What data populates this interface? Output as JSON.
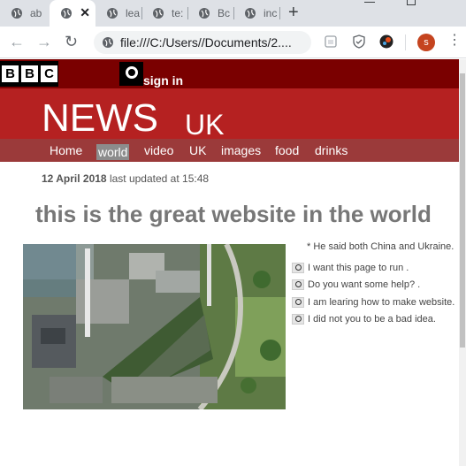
{
  "browser": {
    "tabs": [
      {
        "label": "ab"
      },
      {
        "label": "",
        "active": true
      },
      {
        "label": "lea"
      },
      {
        "label": "te:"
      },
      {
        "label": "Bc"
      },
      {
        "label": "inc"
      }
    ],
    "new_tab_label": "+",
    "url": "file:///C:/Users//Documents/2....",
    "profile_initial": "s"
  },
  "page": {
    "brand_letters": [
      "B",
      "B",
      "C"
    ],
    "signin_label": "sign in",
    "news_title": "NEWS",
    "news_region": "UK",
    "nav": [
      "Home",
      "world",
      "video",
      "UK",
      "images",
      "food",
      "drinks"
    ],
    "active_nav": "world",
    "date": "12 April 2018",
    "updated_text": "last updated at 15:48",
    "headline": "this is the great website in the world",
    "quote": "* He said both China and Ukraine.",
    "side_links": [
      "I want this page to run .",
      "Do you want some help? .",
      "I am learing how to make website.",
      "I did not you to be a bad idea."
    ]
  },
  "colors": {
    "bbc_bar": "#7a0000",
    "news_bar": "#b52121",
    "nav_bar": "#9b3a3a"
  }
}
